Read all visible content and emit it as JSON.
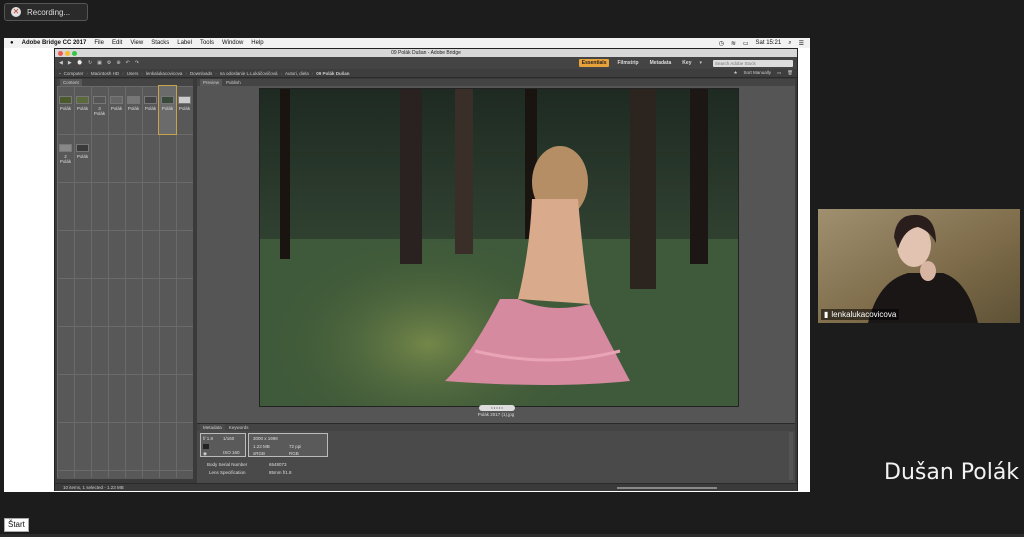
{
  "recording": {
    "label": "Recording...",
    "icon": "close-icon"
  },
  "mac_menu": {
    "app": "Adobe Bridge CC 2017",
    "items": [
      "File",
      "Edit",
      "View",
      "Stacks",
      "Label",
      "Tools",
      "Window",
      "Help"
    ],
    "clock": "Sat 15:21"
  },
  "window": {
    "title": "09 Polák Dušan - Adobe Bridge"
  },
  "toolbar": {
    "workspaces": [
      "Essentials",
      "Filmstrip",
      "Metadata",
      "Key"
    ],
    "active_workspace": "Essentials",
    "search_placeholder": "Search Adobe Stock"
  },
  "path": {
    "items": [
      "Computer",
      "Macintosh HD",
      "Users",
      "lenkalukacovicova",
      "Downloads",
      "na odoslanie L.Lukáčovičová",
      "Autori, diela",
      "09 Polák Dušan"
    ],
    "sort": "Sort Manually"
  },
  "content_panel": {
    "tabs": [
      "Content"
    ],
    "thumbs": [
      {
        "label": "Polák",
        "badge": ""
      },
      {
        "label": "Polák",
        "badge": ""
      },
      {
        "label": "Polák",
        "badge": "3"
      },
      {
        "label": "Polák",
        "badge": ""
      },
      {
        "label": "Polák",
        "badge": ""
      },
      {
        "label": "Polák",
        "badge": ""
      },
      {
        "label": "Polák",
        "badge": ""
      },
      {
        "label": "Polák",
        "badge": ""
      },
      {
        "label": "Polák",
        "badge": "2"
      },
      {
        "label": "Polák",
        "badge": ""
      }
    ]
  },
  "preview_panel": {
    "tabs": [
      "Preview",
      "Publish"
    ],
    "caption": "Polák 2017 (1).jpg"
  },
  "metadata_panel": {
    "tabs": [
      "Metadata",
      "Keywords"
    ],
    "box1": {
      "fstop": "f/ 1.8",
      "shutter": "1/160",
      "iso": "ISO 160"
    },
    "box2": {
      "dims": "3000 x 1998",
      "size": "1.23 MB",
      "ppi": "72 ppi",
      "color": "sRGB",
      "mode": "RGB"
    },
    "fields": [
      {
        "label": "Body Serial Number",
        "value": "6548073"
      },
      {
        "label": "Lens Specification",
        "value": "85mm f/1.8"
      }
    ]
  },
  "status": {
    "text": "10 items, 1 selected - 1.23 MB"
  },
  "webcam": {
    "name": "lenkalukacovicova"
  },
  "presenter_name": "Dušan Polák",
  "start_button": "Štart"
}
